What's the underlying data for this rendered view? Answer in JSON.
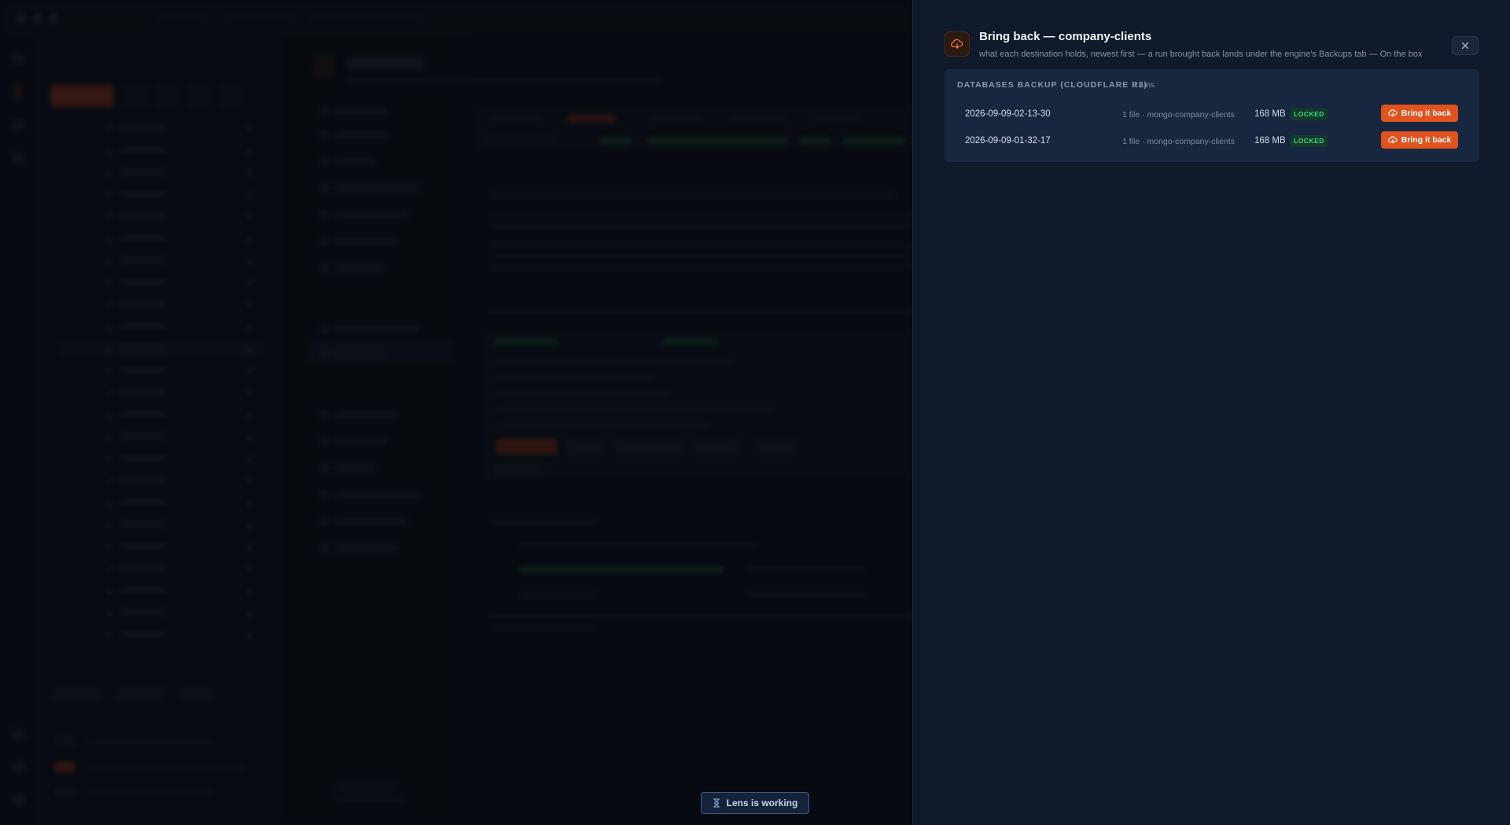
{
  "drawer": {
    "title": "Bring back — company-clients",
    "subtitle": "what each destination holds, newest first — a run brought back lands under the engine's Backups tab — On the box",
    "icon": "cloud-download-icon",
    "close_icon": "close-icon",
    "destination": {
      "name": "DATABASES BACKUP (CLOUDFLARE R2)",
      "runs_label": "2 runs",
      "runs": [
        {
          "name": "2026-09-09-02-13-30",
          "files": "1 file · mongo-company-clients",
          "size": "168 MB",
          "badge": "LOCKED",
          "action": "Bring it back"
        },
        {
          "name": "2026-09-09-01-32-17",
          "files": "1 file · mongo-company-clients",
          "size": "168 MB",
          "badge": "LOCKED",
          "action": "Bring it back"
        }
      ]
    }
  },
  "toast": {
    "label": "Lens is working",
    "icon": "hourglass-icon"
  },
  "colors": {
    "accent": "#e0531f",
    "locked": "#46d38a",
    "drawer_bg": "#111a2a",
    "destination_bg": "#182740"
  }
}
